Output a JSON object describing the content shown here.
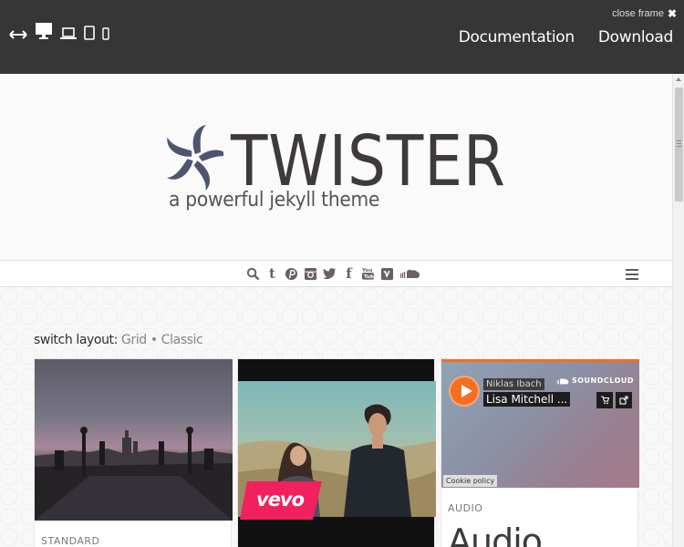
{
  "frame": {
    "close_label": "close frame",
    "close_x": "✖",
    "links": [
      "Documentation",
      "Download"
    ],
    "devices": [
      "resize-icon",
      "desktop-icon",
      "laptop-icon",
      "tablet-icon",
      "phone-icon"
    ]
  },
  "site": {
    "logo": "TWISTER",
    "tagline": "a powerful jekyll theme",
    "social_icons": [
      "search-icon",
      "tumblr-icon",
      "pinterest-icon",
      "instagram-icon",
      "twitter-icon",
      "facebook-icon",
      "youtube-icon",
      "vimeo-icon",
      "soundcloud-icon"
    ],
    "switch_layout": {
      "label": "switch layout:",
      "grid": "Grid",
      "separator": "•",
      "classic": "Classic"
    },
    "cards": [
      {
        "category": "STANDARD"
      },
      {
        "overlay": "vevo"
      },
      {
        "artist": "Niklas Ibach",
        "track": "Lisa Mitchell ...",
        "brand": "SOUNDCLOUD",
        "cookie": "Cookie policy",
        "category": "AUDIO",
        "title": "Audio"
      }
    ]
  },
  "colors": {
    "frame_bg": "#363636",
    "accent": "#f26f21",
    "logo": "#4d5570"
  }
}
